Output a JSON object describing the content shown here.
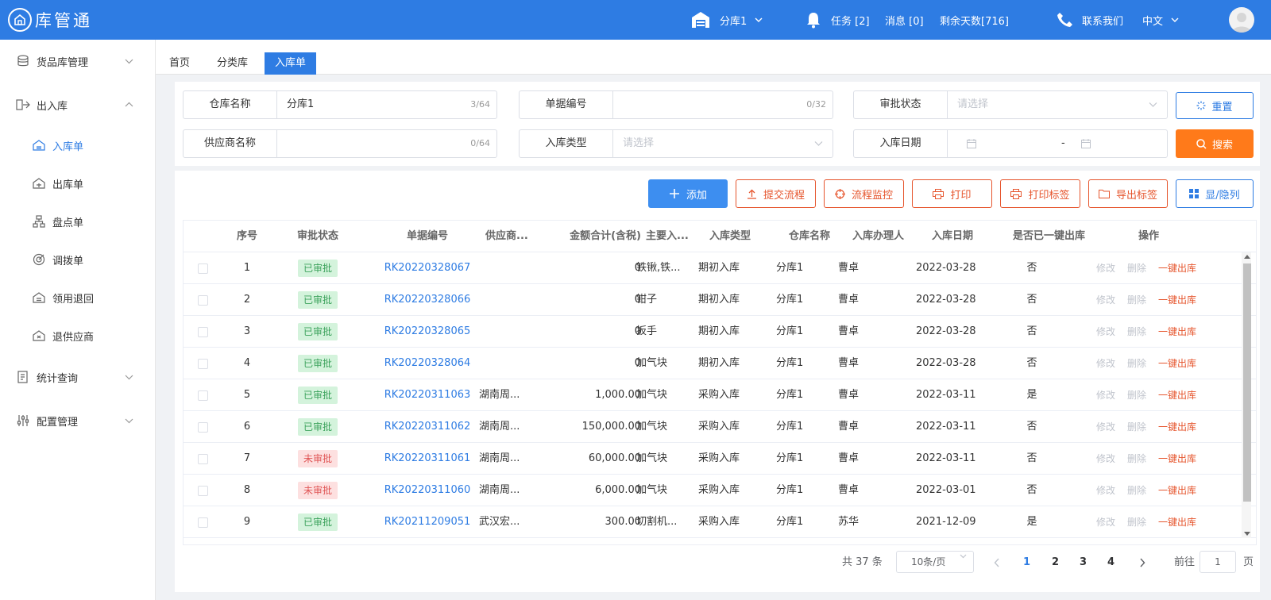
{
  "app": {
    "name": "库管通"
  },
  "header": {
    "warehouse": "分库1",
    "tasks": "任务 [2]",
    "messages": "消息 [0]",
    "remaining_days": "剩余天数[716]",
    "contact": "联系我们",
    "language": "中文"
  },
  "sidebar": {
    "items": [
      {
        "label": "货品库管理"
      },
      {
        "label": "出入库"
      },
      {
        "label": "入库单"
      },
      {
        "label": "出库单"
      },
      {
        "label": "盘点单"
      },
      {
        "label": "调拨单"
      },
      {
        "label": "领用退回"
      },
      {
        "label": "退供应商"
      },
      {
        "label": "统计查询"
      },
      {
        "label": "配置管理"
      }
    ]
  },
  "tabs": [
    {
      "label": "首页"
    },
    {
      "label": "分类库"
    },
    {
      "label": "入库单"
    }
  ],
  "filters": {
    "warehouse_name": {
      "label": "仓库名称",
      "value": "分库1",
      "count": "3/64"
    },
    "doc_no": {
      "label": "单据编号",
      "value": "",
      "count": "0/32"
    },
    "approval_status": {
      "label": "审批状态",
      "placeholder": "请选择"
    },
    "supplier_name": {
      "label": "供应商名称",
      "value": "",
      "count": "0/64"
    },
    "inbound_type": {
      "label": "入库类型",
      "placeholder": "请选择"
    },
    "inbound_date": {
      "label": "入库日期",
      "separator": "-"
    },
    "reset_label": "重置",
    "search_label": "搜索"
  },
  "actions": {
    "add": "添加",
    "submit_flow": "提交流程",
    "monitor_flow": "流程监控",
    "print": "打印",
    "print_label": "打印标签",
    "export_label": "导出标签",
    "toggle_columns": "显/隐列"
  },
  "table": {
    "columns": [
      "序号",
      "审批状态",
      "单据编号",
      "供应商...",
      "金额合计(含税)",
      "主要入...",
      "入库类型",
      "仓库名称",
      "入库办理人",
      "入库日期",
      "是否已一键出库",
      "操作"
    ],
    "op_edit": "修改",
    "op_delete": "删除",
    "op_out": "一键出库",
    "rows": [
      {
        "no": "1",
        "status": "已审批",
        "status_kind": "ok",
        "doc": "RK20220328067",
        "supplier": "",
        "amount": "0",
        "item": "铁锹,铁...",
        "type": "期初入库",
        "wh": "分库1",
        "handler": "曹卓",
        "date": "2022-03-28",
        "out": "否"
      },
      {
        "no": "2",
        "status": "已审批",
        "status_kind": "ok",
        "doc": "RK20220328066",
        "supplier": "",
        "amount": "0",
        "item": "钳子",
        "type": "期初入库",
        "wh": "分库1",
        "handler": "曹卓",
        "date": "2022-03-28",
        "out": "否"
      },
      {
        "no": "3",
        "status": "已审批",
        "status_kind": "ok",
        "doc": "RK20220328065",
        "supplier": "",
        "amount": "0",
        "item": "扳手",
        "type": "期初入库",
        "wh": "分库1",
        "handler": "曹卓",
        "date": "2022-03-28",
        "out": "否"
      },
      {
        "no": "4",
        "status": "已审批",
        "status_kind": "ok",
        "doc": "RK20220328064",
        "supplier": "",
        "amount": "0",
        "item": "加气块",
        "type": "期初入库",
        "wh": "分库1",
        "handler": "曹卓",
        "date": "2022-03-28",
        "out": "否"
      },
      {
        "no": "5",
        "status": "已审批",
        "status_kind": "ok",
        "doc": "RK20220311063",
        "supplier": "湖南周...",
        "amount": "1,000.00",
        "item": "加气块",
        "type": "采购入库",
        "wh": "分库1",
        "handler": "曹卓",
        "date": "2022-03-11",
        "out": "是"
      },
      {
        "no": "6",
        "status": "已审批",
        "status_kind": "ok",
        "doc": "RK20220311062",
        "supplier": "湖南周...",
        "amount": "150,000.00",
        "item": "加气块",
        "type": "采购入库",
        "wh": "分库1",
        "handler": "曹卓",
        "date": "2022-03-11",
        "out": "否"
      },
      {
        "no": "7",
        "status": "未审批",
        "status_kind": "no",
        "doc": "RK20220311061",
        "supplier": "湖南周...",
        "amount": "60,000.00",
        "item": "加气块",
        "type": "采购入库",
        "wh": "分库1",
        "handler": "曹卓",
        "date": "2022-03-11",
        "out": "否"
      },
      {
        "no": "8",
        "status": "未审批",
        "status_kind": "no",
        "doc": "RK20220311060",
        "supplier": "湖南周...",
        "amount": "6,000.00",
        "item": "加气块",
        "type": "采购入库",
        "wh": "分库1",
        "handler": "曹卓",
        "date": "2022-03-01",
        "out": "否"
      },
      {
        "no": "9",
        "status": "已审批",
        "status_kind": "ok",
        "doc": "RK20211209051",
        "supplier": "武汉宏...",
        "amount": "300.00",
        "item": "切割机...",
        "type": "采购入库",
        "wh": "分库1",
        "handler": "苏华",
        "date": "2021-12-09",
        "out": "是"
      }
    ]
  },
  "pagination": {
    "total": "共 37 条",
    "page_size": "10条/页",
    "pages": [
      "1",
      "2",
      "3",
      "4"
    ],
    "current": "1",
    "goto_label": "前往",
    "goto_value": "1",
    "page_unit": "页"
  },
  "colors": {
    "primary": "#2e7ce3",
    "danger": "#e6552d",
    "search": "#ff7a1a"
  }
}
